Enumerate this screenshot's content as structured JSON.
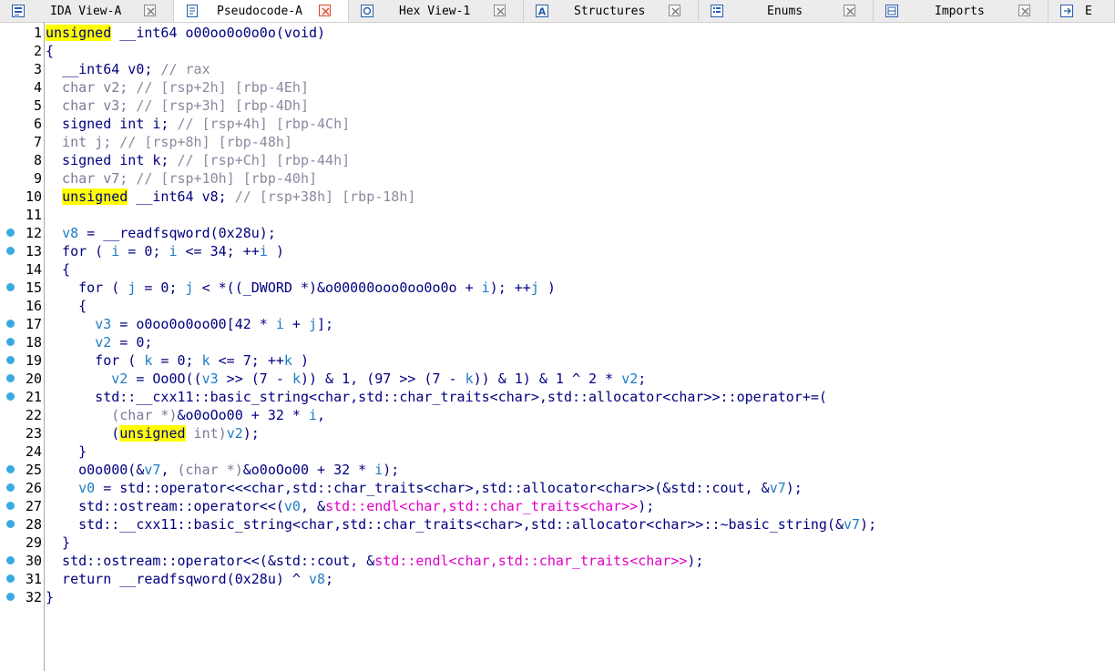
{
  "tabs": [
    {
      "label": "IDA View-A",
      "icon": "ida-view-icon",
      "active": false
    },
    {
      "label": "Pseudocode-A",
      "icon": "pseudocode-icon",
      "active": true
    },
    {
      "label": "Hex View-1",
      "icon": "hex-view-icon",
      "active": false
    },
    {
      "label": "Structures",
      "icon": "structures-icon",
      "active": false
    },
    {
      "label": "Enums",
      "icon": "enums-icon",
      "active": false
    },
    {
      "label": "Imports",
      "icon": "imports-icon",
      "active": false
    },
    {
      "label": "E",
      "icon": "exports-icon",
      "active": false
    }
  ],
  "colors": {
    "breakpoint": "#39a9e2",
    "highlight": "#ffff00",
    "keyword": "#000080",
    "comment": "#8a8aa0",
    "magenta": "#e000c8"
  },
  "lines": [
    {
      "n": "1",
      "bp": false,
      "segs": [
        [
          "hl",
          "unsigned"
        ],
        [
          "p",
          " __int64 o00oo0o0o0o(void)"
        ]
      ]
    },
    {
      "n": "2",
      "bp": false,
      "segs": [
        [
          "p",
          "{"
        ]
      ]
    },
    {
      "n": "3",
      "bp": false,
      "segs": [
        [
          "p",
          "  __int64 v0; "
        ],
        [
          "c",
          "// rax"
        ]
      ]
    },
    {
      "n": "4",
      "bp": false,
      "segs": [
        [
          "g",
          "  char v2; "
        ],
        [
          "c",
          "// [rsp+2h] [rbp-4Eh]"
        ]
      ]
    },
    {
      "n": "5",
      "bp": false,
      "segs": [
        [
          "g",
          "  char v3; "
        ],
        [
          "c",
          "// [rsp+3h] [rbp-4Dh]"
        ]
      ]
    },
    {
      "n": "6",
      "bp": false,
      "segs": [
        [
          "p",
          "  signed int i; "
        ],
        [
          "c",
          "// [rsp+4h] [rbp-4Ch]"
        ]
      ]
    },
    {
      "n": "7",
      "bp": false,
      "segs": [
        [
          "g",
          "  int j; "
        ],
        [
          "c",
          "// [rsp+8h] [rbp-48h]"
        ]
      ]
    },
    {
      "n": "8",
      "bp": false,
      "segs": [
        [
          "p",
          "  signed int k; "
        ],
        [
          "c",
          "// [rsp+Ch] [rbp-44h]"
        ]
      ]
    },
    {
      "n": "9",
      "bp": false,
      "segs": [
        [
          "g",
          "  char v7; "
        ],
        [
          "c",
          "// [rsp+10h] [rbp-40h]"
        ]
      ]
    },
    {
      "n": "10",
      "bp": false,
      "segs": [
        [
          "p",
          "  "
        ],
        [
          "hl",
          "unsigned"
        ],
        [
          "p",
          " __int64 v8; "
        ],
        [
          "c",
          "// [rsp+38h] [rbp-18h]"
        ]
      ]
    },
    {
      "n": "11",
      "bp": false,
      "segs": [
        [
          "p",
          ""
        ]
      ]
    },
    {
      "n": "12",
      "bp": true,
      "segs": [
        [
          "p",
          "  "
        ],
        [
          "v",
          "v8"
        ],
        [
          "p",
          " = __readfsqword(0x28u);"
        ]
      ]
    },
    {
      "n": "13",
      "bp": true,
      "segs": [
        [
          "p",
          "  for ( "
        ],
        [
          "v",
          "i"
        ],
        [
          "p",
          " = 0; "
        ],
        [
          "v",
          "i"
        ],
        [
          "p",
          " <= 34; ++"
        ],
        [
          "v",
          "i"
        ],
        [
          "p",
          " )"
        ]
      ]
    },
    {
      "n": "14",
      "bp": false,
      "segs": [
        [
          "p",
          "  {"
        ]
      ]
    },
    {
      "n": "15",
      "bp": true,
      "segs": [
        [
          "p",
          "    for ( "
        ],
        [
          "v",
          "j"
        ],
        [
          "p",
          " = 0; "
        ],
        [
          "v",
          "j"
        ],
        [
          "p",
          " < *((_DWORD *)&o00000ooo0oo0o0o + "
        ],
        [
          "v",
          "i"
        ],
        [
          "p",
          "); ++"
        ],
        [
          "v",
          "j"
        ],
        [
          "p",
          " )"
        ]
      ]
    },
    {
      "n": "16",
      "bp": false,
      "segs": [
        [
          "p",
          "    {"
        ]
      ]
    },
    {
      "n": "17",
      "bp": true,
      "segs": [
        [
          "p",
          "      "
        ],
        [
          "v",
          "v3"
        ],
        [
          "p",
          " = o0oo0o0oo00[42 * "
        ],
        [
          "v",
          "i"
        ],
        [
          "p",
          " + "
        ],
        [
          "v",
          "j"
        ],
        [
          "p",
          "];"
        ]
      ]
    },
    {
      "n": "18",
      "bp": true,
      "segs": [
        [
          "p",
          "      "
        ],
        [
          "v",
          "v2"
        ],
        [
          "p",
          " = 0;"
        ]
      ]
    },
    {
      "n": "19",
      "bp": true,
      "segs": [
        [
          "p",
          "      for ( "
        ],
        [
          "v",
          "k"
        ],
        [
          "p",
          " = 0; "
        ],
        [
          "v",
          "k"
        ],
        [
          "p",
          " <= 7; ++"
        ],
        [
          "v",
          "k"
        ],
        [
          "p",
          " )"
        ]
      ]
    },
    {
      "n": "20",
      "bp": true,
      "segs": [
        [
          "p",
          "        "
        ],
        [
          "v",
          "v2"
        ],
        [
          "p",
          " = Oo0O(("
        ],
        [
          "v",
          "v3"
        ],
        [
          "p",
          " >> (7 - "
        ],
        [
          "v",
          "k"
        ],
        [
          "p",
          ")) & 1, (97 >> (7 - "
        ],
        [
          "v",
          "k"
        ],
        [
          "p",
          ")) & 1) & 1 ^ 2 * "
        ],
        [
          "v",
          "v2"
        ],
        [
          "p",
          ";"
        ]
      ]
    },
    {
      "n": "21",
      "bp": true,
      "segs": [
        [
          "p",
          "      std::__cxx11::basic_string<char,std::char_traits<char>,std::allocator<char>>::operator+=("
        ]
      ]
    },
    {
      "n": "22",
      "bp": false,
      "segs": [
        [
          "p",
          "        "
        ],
        [
          "g",
          "(char *)"
        ],
        [
          "p",
          "&o0oOo00 + 32 * "
        ],
        [
          "v",
          "i"
        ],
        [
          "p",
          ","
        ]
      ]
    },
    {
      "n": "23",
      "bp": false,
      "segs": [
        [
          "p",
          "        ("
        ],
        [
          "hl",
          "unsigned"
        ],
        [
          "g",
          " int)"
        ],
        [
          "v",
          "v2"
        ],
        [
          "p",
          ");"
        ]
      ]
    },
    {
      "n": "24",
      "bp": false,
      "segs": [
        [
          "p",
          "    }"
        ]
      ]
    },
    {
      "n": "25",
      "bp": true,
      "segs": [
        [
          "p",
          "    o0o000(&"
        ],
        [
          "v",
          "v7"
        ],
        [
          "p",
          ", "
        ],
        [
          "g",
          "(char *)"
        ],
        [
          "p",
          "&o0oOo00 + 32 * "
        ],
        [
          "v",
          "i"
        ],
        [
          "p",
          ");"
        ]
      ]
    },
    {
      "n": "26",
      "bp": true,
      "segs": [
        [
          "p",
          "    "
        ],
        [
          "v",
          "v0"
        ],
        [
          "p",
          " = std::operator<<<char,std::char_traits<char>,std::allocator<char>>(&std::cout, &"
        ],
        [
          "v",
          "v7"
        ],
        [
          "p",
          ");"
        ]
      ]
    },
    {
      "n": "27",
      "bp": true,
      "segs": [
        [
          "p",
          "    std::ostream::operator<<("
        ],
        [
          "v",
          "v0"
        ],
        [
          "p",
          ", &"
        ],
        [
          "m",
          "std::endl<char,std::char_traits<char>>"
        ],
        [
          "p",
          ");"
        ]
      ]
    },
    {
      "n": "28",
      "bp": true,
      "segs": [
        [
          "p",
          "    std::__cxx11::basic_string<char,std::char_traits<char>,std::allocator<char>>::~basic_string(&"
        ],
        [
          "v",
          "v7"
        ],
        [
          "p",
          ");"
        ]
      ]
    },
    {
      "n": "29",
      "bp": false,
      "segs": [
        [
          "p",
          "  }"
        ]
      ]
    },
    {
      "n": "30",
      "bp": true,
      "segs": [
        [
          "p",
          "  std::ostream::operator<<(&std::cout, &"
        ],
        [
          "m",
          "std::endl<char,std::char_traits<char>>"
        ],
        [
          "p",
          ");"
        ]
      ]
    },
    {
      "n": "31",
      "bp": true,
      "segs": [
        [
          "p",
          "  return __readfsqword(0x28u) ^ "
        ],
        [
          "v",
          "v8"
        ],
        [
          "p",
          ";"
        ]
      ]
    },
    {
      "n": "32",
      "bp": true,
      "segs": [
        [
          "p",
          "}"
        ]
      ]
    }
  ]
}
